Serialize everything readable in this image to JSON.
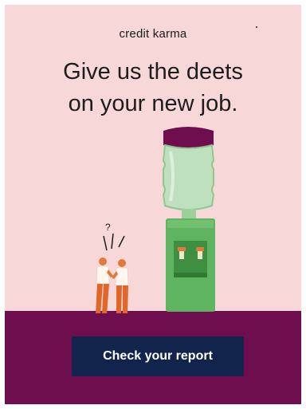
{
  "brand": {
    "logo_text": "credit karma"
  },
  "headline": {
    "line1": "Give us the deets",
    "line2": "on your new job."
  },
  "cta": {
    "label": "Check your report"
  },
  "illustration": {
    "scene": "two coworkers chatting by a water cooler",
    "speech_mark": "?"
  },
  "colors": {
    "background": "#f7d7d8",
    "floor": "#6f0e4f",
    "button": "#12244b",
    "cooler_green": "#5fb45f",
    "cooler_cap": "#6f0e4f"
  }
}
